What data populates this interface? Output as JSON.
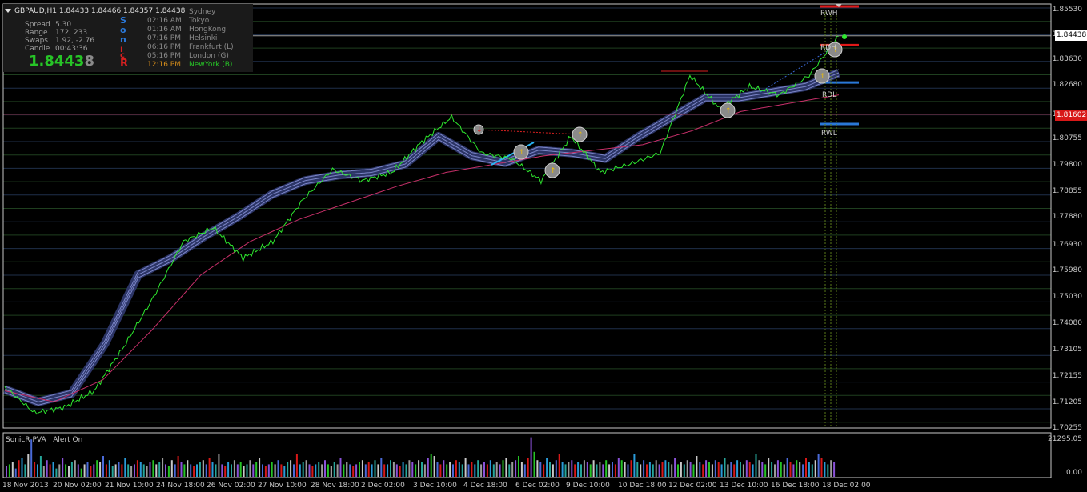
{
  "header": {
    "text": "GBPAUD,H1  1.84433 1.84466 1.84357 1.84438"
  },
  "stats": [
    {
      "label": "Spread",
      "value": "5.30"
    },
    {
      "label": "Range",
      "value": "172, 233"
    },
    {
      "label": "Swaps",
      "value": "1.92, -2.76"
    },
    {
      "label": "Candle",
      "value": "00:43:36"
    }
  ],
  "price": {
    "main": "1.8443",
    "last_digit": "8"
  },
  "sonic_letters": [
    "S",
    "o",
    "n",
    "i",
    "c",
    "R"
  ],
  "sessions": [
    {
      "time": "",
      "city": "Sydney",
      "color": "#8a8a8a"
    },
    {
      "time": "02:16 AM",
      "city": "Tokyo",
      "color": "#8a8a8a"
    },
    {
      "time": "01:16 AM",
      "city": "HongKong",
      "color": "#8a8a8a"
    },
    {
      "time": "07:16 PM",
      "city": "Helsinki",
      "color": "#8a8a8a"
    },
    {
      "time": "06:16 PM",
      "city": "Frankfurt  (L)",
      "color": "#8a8a8a"
    },
    {
      "time": "05:16 PM",
      "city": "London  (G)",
      "color": "#8a8a8a"
    },
    {
      "time": "12:16 PM",
      "city": "NewYork  (B)",
      "color": "#d08a1a",
      "city_color": "#27c427"
    }
  ],
  "price_axis": [
    "1.85530",
    "1.84438",
    "1.83630",
    "1.82680",
    "1.81602",
    "1.80755",
    "1.79800",
    "1.78855",
    "1.77880",
    "1.76930",
    "1.75980",
    "1.75030",
    "1.74080",
    "1.73105",
    "1.72155",
    "1.71205",
    "1.70255"
  ],
  "tags": {
    "current": "1.84438",
    "red_line": "1.81602"
  },
  "dates": [
    "18 Nov 2013",
    "20 Nov 02:00",
    "21 Nov 10:00",
    "24 Nov 18:00",
    "26 Nov 02:00",
    "27 Nov 10:00",
    "28 Nov 18:00",
    "2 Dec 02:00",
    "3 Dec 10:00",
    "4 Dec 18:00",
    "6 Dec 02:00",
    "9 Dec 10:00",
    "10 Dec 18:00",
    "12 Dec 02:00",
    "13 Dec 10:00",
    "16 Dec 18:00",
    "18 Dec 02:00"
  ],
  "indicator": {
    "name": "SonicR PVA",
    "alert": "Alert On"
  },
  "volume_axis": {
    "max": "21295.05",
    "min": "0.00"
  },
  "levels": {
    "rwh": {
      "label": "RWH",
      "value": 1.855,
      "color": "#e01818"
    },
    "rdh": {
      "label": "RDH",
      "value": 1.841,
      "color": "#e01818"
    },
    "rdl": {
      "label": "RDL",
      "value": 1.8275,
      "color": "#2a78d8"
    },
    "rwl": {
      "label": "RWL",
      "value": 1.8125,
      "color": "#2a78d8"
    }
  },
  "colors": {
    "price": "#2ee82e",
    "band": "#2c3566",
    "band_core": "#7c86c8",
    "ema": "#c8306a",
    "grid": "#1f2f4a",
    "grid_alt": "#1f3f1f",
    "red_line": "#d81818"
  },
  "chart_data": {
    "type": "line",
    "symbol": "GBPAUD",
    "timeframe": "H1",
    "ylim": [
      1.70255,
      1.8553
    ],
    "categories": [
      "18 Nov 2013",
      "20 Nov 02:00",
      "21 Nov 10:00",
      "24 Nov 18:00",
      "26 Nov 02:00",
      "27 Nov 10:00",
      "28 Nov 18:00",
      "2 Dec 02:00",
      "3 Dec 10:00",
      "4 Dec 18:00",
      "6 Dec 02:00",
      "9 Dec 10:00",
      "10 Dec 18:00",
      "12 Dec 02:00",
      "13 Dec 10:00",
      "16 Dec 18:00",
      "18 Dec 02:00"
    ],
    "series": [
      {
        "name": "",
        "values": [
          1.7175,
          1.708,
          1.71,
          1.716,
          1.732,
          1.75,
          1.77,
          1.775,
          1.764,
          1.77,
          1.785,
          1.796,
          1.792,
          1.795,
          1.806,
          1.815,
          1.802,
          1.8,
          1.792,
          1.808,
          1.795,
          1.798,
          1.802,
          1.83,
          1.818,
          1.826,
          1.823,
          1.83,
          1.8443
        ]
      },
      {
        "name": "",
        "values": [
          1.7165,
          1.712,
          1.715,
          1.733,
          1.758,
          1.764,
          1.772,
          1.779,
          1.787,
          1.792,
          1.794,
          1.795,
          1.798,
          1.808,
          1.801,
          1.7985,
          1.803,
          1.802,
          1.8,
          1.808,
          1.815,
          1.822,
          1.822,
          1.824,
          1.826,
          1.831
        ]
      },
      {
        "name": "",
        "values": [
          1.716,
          1.712,
          1.72,
          1.738,
          1.758,
          1.77,
          1.778,
          1.784,
          1.79,
          1.795,
          1.798,
          1.801,
          1.803,
          1.805,
          1.81,
          1.817,
          1.82,
          1.823
        ]
      }
    ],
    "hlines": [
      1.81602,
      1.84438
    ],
    "volumes": [
      0.25,
      0.3,
      0.35,
      0.2,
      0.4,
      0.45,
      0.3,
      0.55,
      0.9,
      0.35,
      0.3,
      0.5,
      0.25,
      0.4,
      0.3,
      0.35,
      0.2,
      0.3,
      0.45,
      0.3,
      0.25,
      0.35,
      0.4,
      0.3,
      0.2,
      0.3,
      0.35,
      0.25,
      0.3,
      0.4,
      0.35,
      0.5,
      0.3,
      0.4,
      0.25,
      0.3,
      0.35,
      0.3,
      0.45,
      0.3,
      0.25,
      0.3,
      0.4,
      0.35,
      0.3,
      0.25,
      0.35,
      0.4,
      0.3,
      0.35,
      0.45,
      0.3,
      0.25,
      0.4,
      0.3,
      0.5,
      0.35,
      0.3,
      0.4,
      0.3,
      0.25,
      0.3,
      0.35,
      0.4,
      0.3,
      0.45,
      0.35,
      0.3,
      0.55,
      0.3,
      0.25,
      0.35,
      0.3,
      0.4,
      0.3,
      0.35,
      0.25,
      0.3,
      0.4,
      0.3,
      0.35,
      0.45,
      0.3,
      0.25,
      0.3,
      0.35,
      0.3,
      0.4,
      0.3,
      0.25,
      0.35,
      0.4,
      0.3,
      0.55,
      0.3,
      0.35,
      0.4,
      0.3,
      0.25,
      0.3,
      0.35,
      0.3,
      0.4,
      0.3,
      0.25,
      0.35,
      0.3,
      0.45,
      0.3,
      0.35,
      0.3,
      0.25,
      0.3,
      0.35,
      0.4,
      0.3,
      0.35,
      0.3,
      0.4,
      0.3,
      0.45,
      0.3,
      0.3,
      0.4,
      0.35,
      0.3,
      0.25,
      0.35,
      0.3,
      0.4,
      0.35,
      0.3,
      0.4,
      0.35,
      0.3,
      0.45,
      0.55,
      0.5,
      0.35,
      0.3,
      0.4,
      0.3,
      0.35,
      0.3,
      0.4,
      0.35,
      0.3,
      0.45,
      0.3,
      0.35,
      0.3,
      0.4,
      0.3,
      0.35,
      0.3,
      0.4,
      0.3,
      0.35,
      0.3,
      0.4,
      0.45,
      0.3,
      0.35,
      0.4,
      0.5,
      0.35,
      0.3,
      0.45,
      0.95,
      0.6,
      0.4,
      0.35,
      0.3,
      0.45,
      0.35,
      0.3,
      0.4,
      0.55,
      0.35,
      0.3,
      0.35,
      0.4,
      0.3,
      0.35,
      0.3,
      0.4,
      0.35,
      0.3,
      0.4,
      0.3,
      0.35,
      0.3,
      0.4,
      0.3,
      0.35,
      0.3,
      0.45,
      0.4,
      0.35,
      0.3,
      0.4,
      0.55,
      0.35,
      0.3,
      0.4,
      0.3,
      0.35,
      0.3,
      0.4,
      0.3,
      0.35,
      0.4,
      0.35,
      0.3,
      0.45,
      0.3,
      0.35,
      0.3,
      0.4,
      0.35,
      0.3,
      0.5,
      0.35,
      0.3,
      0.4,
      0.35,
      0.3,
      0.4,
      0.35,
      0.3,
      0.45,
      0.3,
      0.35,
      0.3,
      0.4,
      0.35,
      0.3,
      0.4,
      0.35,
      0.3,
      0.55,
      0.4,
      0.35,
      0.3,
      0.45,
      0.35,
      0.3,
      0.4,
      0.35,
      0.3,
      0.45,
      0.35,
      0.3,
      0.4,
      0.35,
      0.3,
      0.45,
      0.35,
      0.3,
      0.4,
      0.55,
      0.45,
      0.35,
      0.3,
      0.4,
      0.35
    ]
  }
}
